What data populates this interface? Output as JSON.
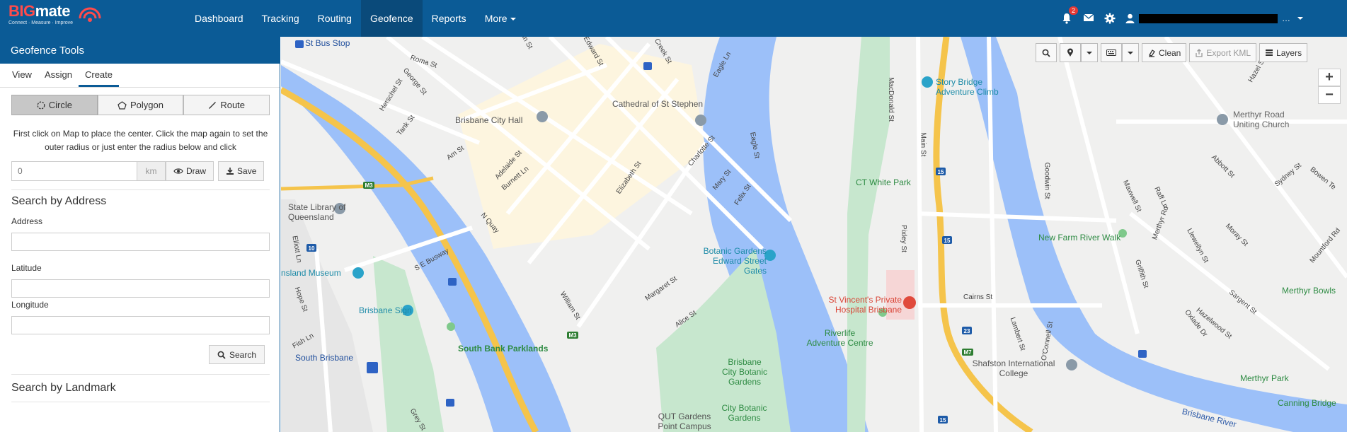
{
  "brand": {
    "name_part1": "BIG",
    "name_part2": "mate",
    "tagline": "Connect · Measure · Improve"
  },
  "nav": {
    "items": [
      "Dashboard",
      "Tracking",
      "Routing",
      "Geofence",
      "Reports",
      "More"
    ],
    "active": "Geofence"
  },
  "header_right": {
    "notification_count": "2"
  },
  "panel": {
    "title": "Geofence Tools",
    "tabs": [
      "View",
      "Assign",
      "Create"
    ],
    "active_tab": "Create",
    "shapes": [
      "Circle",
      "Polygon",
      "Route"
    ],
    "instructions": "First click on Map to place the center. Click the map again to set the outer radius or just enter the radius below and click",
    "radius_placeholder": "0",
    "radius_unit": "km",
    "draw_label": "Draw",
    "save_label": "Save",
    "search_address_title": "Search by Address",
    "address_label": "Address",
    "latitude_label": "Latitude",
    "longitude_label": "Longitude",
    "search_label": "Search",
    "search_landmark_title": "Search by Landmark"
  },
  "map_toolbar": {
    "clean_label": "Clean",
    "export_label": "Export KML",
    "layers_label": "Layers",
    "zoom_in": "+",
    "zoom_out": "−"
  },
  "map": {
    "pois": [
      "St Bus Stop",
      "Story Bridge Adventure Climb",
      "Merthyr Road Uniting Church",
      "Brisbane City Hall",
      "Cathedral of St Stephen",
      "CT White Park",
      "State Library of Queensland",
      "New Farm River Walk",
      "Botanic Gardens Edward Street Gates",
      "nsland Museum",
      "St Vincent's Private Hospital Brisbane",
      "Brisbane Sign",
      "Riverlife Adventure Centre",
      "South Bank Parklands",
      "South Brisbane",
      "Brisbane City Botanic Gardens",
      "City Botanic Gardens",
      "QUT Gardens Point Campus",
      "Shafston International College",
      "Merthyr Park",
      "Canning Bridge",
      "Brisbane River",
      "Merthyr Bowls"
    ],
    "streets": [
      "Roma St",
      "George St",
      "Herschel St",
      "Tank St",
      "Am St",
      "Adelaide St",
      "Burnett Ln",
      "Elizabeth St",
      "Edward St",
      "Creek St",
      "Eagle Ln",
      "Charlotte St",
      "Mary St",
      "Felix St",
      "Eagle St",
      "N Quay",
      "S E Busway",
      "William St",
      "Margaret St",
      "Alice St",
      "Hope St",
      "Fish Ln",
      "Grey St",
      "Main St",
      "MacDonald St",
      "Pixley St",
      "Cairns St",
      "Lambert St",
      "O'Connell St",
      "Goodwin St",
      "Maxwell St",
      "Raff Ln",
      "Merthyr Rd",
      "Abbott St",
      "Sydney St",
      "Bowen Te",
      "Llewellyn St",
      "Moray St",
      "Griffith St",
      "Hazelwood St",
      "Sargent St",
      "Oxlade Dr",
      "Mountford Rd",
      "Hazel St",
      "Elliott Ln",
      "Ann St"
    ],
    "highway_shields": [
      "M3",
      "15",
      "23",
      "M7",
      "10",
      "15"
    ]
  }
}
